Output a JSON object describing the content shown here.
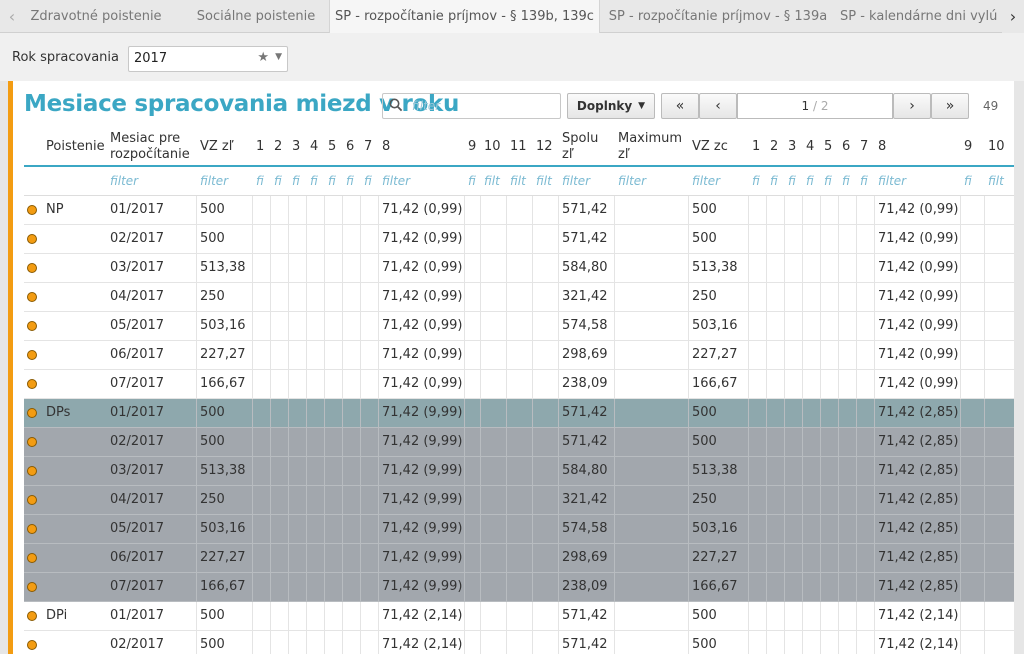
{
  "tabs": [
    {
      "label": "Zdravotné poistenie",
      "active": false
    },
    {
      "label": "Sociálne poistenie",
      "active": false
    },
    {
      "label": "SP - rozpočítanie príjmov - § 139b, 139c",
      "active": true
    },
    {
      "label": "SP - rozpočítanie príjmov - § 139a",
      "active": false
    },
    {
      "label": "SP - kalendárne dni vylú",
      "active": false
    }
  ],
  "year": {
    "label": "Rok spracovania",
    "value": "2017"
  },
  "panel": {
    "title": "Mesiace spracovania miezd v roku",
    "filter_placeholder": "filter",
    "doplnky_label": "Doplnky",
    "pager": {
      "current": "1",
      "total": "/ 2",
      "first": "«",
      "prev": "‹",
      "next": "›",
      "last": "»"
    },
    "count": "49"
  },
  "table": {
    "headers": [
      "Poistenie",
      "Mesiac pre rozpočítanie",
      "VZ zľ",
      "1",
      "2",
      "3",
      "4",
      "5",
      "6",
      "7",
      "8",
      "9",
      "10",
      "11",
      "12",
      "Spolu zľ",
      "Maximum zľ",
      "VZ zc",
      "1",
      "2",
      "3",
      "4",
      "5",
      "6",
      "7",
      "8",
      "9",
      "10"
    ],
    "filters": [
      "",
      "filter",
      "filter",
      "fi",
      "fi",
      "fi",
      "fi",
      "fi",
      "fi",
      "fi",
      "filter",
      "fi",
      "filt",
      "filt",
      "filt",
      "filter",
      "filter",
      "filter",
      "fi",
      "fi",
      "fi",
      "fi",
      "fi",
      "fi",
      "fi",
      "filter",
      "fi",
      "filt"
    ],
    "rows": [
      {
        "group": "NP",
        "poistenie": "NP",
        "mesiac": "01/2017",
        "vz": "500",
        "m8": "71,42 (0,99)",
        "spolu": "571,42",
        "vzzc": "500",
        "m8b": "71,42 (0,99)"
      },
      {
        "group": "NP",
        "poistenie": "",
        "mesiac": "02/2017",
        "vz": "500",
        "m8": "71,42 (0,99)",
        "spolu": "571,42",
        "vzzc": "500",
        "m8b": "71,42 (0,99)"
      },
      {
        "group": "NP",
        "poistenie": "",
        "mesiac": "03/2017",
        "vz": "513,38",
        "m8": "71,42 (0,99)",
        "spolu": "584,80",
        "vzzc": "513,38",
        "m8b": "71,42 (0,99)"
      },
      {
        "group": "NP",
        "poistenie": "",
        "mesiac": "04/2017",
        "vz": "250",
        "m8": "71,42 (0,99)",
        "spolu": "321,42",
        "vzzc": "250",
        "m8b": "71,42 (0,99)"
      },
      {
        "group": "NP",
        "poistenie": "",
        "mesiac": "05/2017",
        "vz": "503,16",
        "m8": "71,42 (0,99)",
        "spolu": "574,58",
        "vzzc": "503,16",
        "m8b": "71,42 (0,99)"
      },
      {
        "group": "NP",
        "poistenie": "",
        "mesiac": "06/2017",
        "vz": "227,27",
        "m8": "71,42 (0,99)",
        "spolu": "298,69",
        "vzzc": "227,27",
        "m8b": "71,42 (0,99)"
      },
      {
        "group": "NP",
        "poistenie": "",
        "mesiac": "07/2017",
        "vz": "166,67",
        "m8": "71,42 (0,99)",
        "spolu": "238,09",
        "vzzc": "166,67",
        "m8b": "71,42 (0,99)"
      },
      {
        "group": "DPs",
        "poistenie": "DPs",
        "mesiac": "01/2017",
        "vz": "500",
        "m8": "71,42 (9,99)",
        "spolu": "571,42",
        "vzzc": "500",
        "m8b": "71,42 (2,85)"
      },
      {
        "group": "DPs",
        "poistenie": "",
        "mesiac": "02/2017",
        "vz": "500",
        "m8": "71,42 (9,99)",
        "spolu": "571,42",
        "vzzc": "500",
        "m8b": "71,42 (2,85)"
      },
      {
        "group": "DPs",
        "poistenie": "",
        "mesiac": "03/2017",
        "vz": "513,38",
        "m8": "71,42 (9,99)",
        "spolu": "584,80",
        "vzzc": "513,38",
        "m8b": "71,42 (2,85)"
      },
      {
        "group": "DPs",
        "poistenie": "",
        "mesiac": "04/2017",
        "vz": "250",
        "m8": "71,42 (9,99)",
        "spolu": "321,42",
        "vzzc": "250",
        "m8b": "71,42 (2,85)"
      },
      {
        "group": "DPs",
        "poistenie": "",
        "mesiac": "05/2017",
        "vz": "503,16",
        "m8": "71,42 (9,99)",
        "spolu": "574,58",
        "vzzc": "503,16",
        "m8b": "71,42 (2,85)"
      },
      {
        "group": "DPs",
        "poistenie": "",
        "mesiac": "06/2017",
        "vz": "227,27",
        "m8": "71,42 (9,99)",
        "spolu": "298,69",
        "vzzc": "227,27",
        "m8b": "71,42 (2,85)"
      },
      {
        "group": "DPs",
        "poistenie": "",
        "mesiac": "07/2017",
        "vz": "166,67",
        "m8": "71,42 (9,99)",
        "spolu": "238,09",
        "vzzc": "166,67",
        "m8b": "71,42 (2,85)"
      },
      {
        "group": "DPi",
        "poistenie": "DPi",
        "mesiac": "01/2017",
        "vz": "500",
        "m8": "71,42 (2,14)",
        "spolu": "571,42",
        "vzzc": "500",
        "m8b": "71,42 (2,14)"
      },
      {
        "group": "DPi",
        "poistenie": "",
        "mesiac": "02/2017",
        "vz": "500",
        "m8": "71,42 (2,14)",
        "spolu": "571,42",
        "vzzc": "500",
        "m8b": "71,42 (2,14)"
      }
    ]
  },
  "colors": {
    "accent": "#3ba7c4",
    "status_dot": "#f39c12",
    "selected_row": "#a2a7ad"
  }
}
